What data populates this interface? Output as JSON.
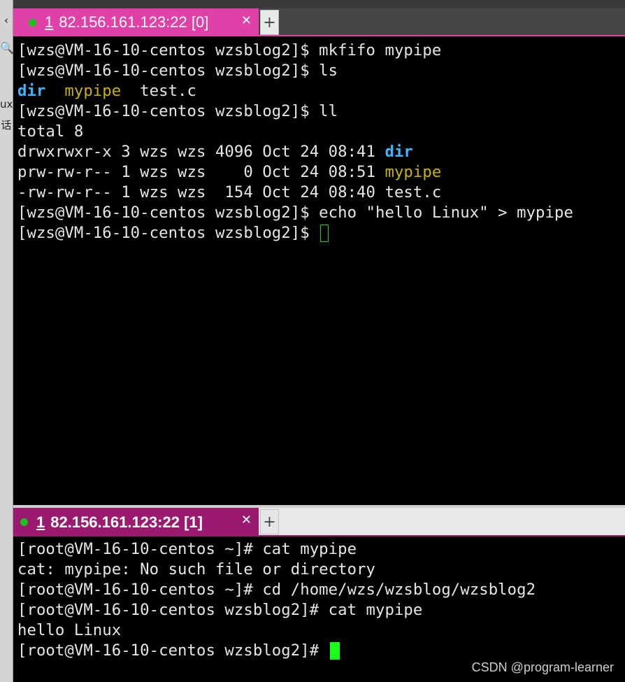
{
  "left_strip": {
    "glyphs": [
      "‹",
      "🔍",
      "ux",
      "话"
    ]
  },
  "top_pane": {
    "tab": {
      "number": "1",
      "title": "82.156.161.123:22 [0]",
      "status_color": "#19c319",
      "accent": "#e040a8"
    },
    "lines": [
      {
        "parts": [
          {
            "text": "[wzs@VM-16-10-centos wzsblog2]$ mkfifo mypipe"
          }
        ]
      },
      {
        "parts": [
          {
            "text": "[wzs@VM-16-10-centos wzsblog2]$ ls"
          }
        ]
      },
      {
        "parts": [
          {
            "text": "dir",
            "style": "dir"
          },
          {
            "text": "  "
          },
          {
            "text": "mypipe",
            "style": "pipe"
          },
          {
            "text": "  test.c"
          }
        ]
      },
      {
        "parts": [
          {
            "text": "[wzs@VM-16-10-centos wzsblog2]$ ll"
          }
        ]
      },
      {
        "parts": [
          {
            "text": "total 8"
          }
        ]
      },
      {
        "parts": [
          {
            "text": "drwxrwxr-x 3 wzs wzs 4096 Oct 24 08:41 "
          },
          {
            "text": "dir",
            "style": "dir"
          }
        ]
      },
      {
        "parts": [
          {
            "text": "prw-rw-r-- 1 wzs wzs    0 Oct 24 08:51 "
          },
          {
            "text": "mypipe",
            "style": "pipe"
          }
        ]
      },
      {
        "parts": [
          {
            "text": "-rw-rw-r-- 1 wzs wzs  154 Oct 24 08:40 test.c"
          }
        ]
      },
      {
        "parts": [
          {
            "text": "[wzs@VM-16-10-centos wzsblog2]$ echo \"hello Linux\" > mypipe"
          }
        ]
      },
      {
        "parts": [
          {
            "text": "[wzs@VM-16-10-centos wzsblog2]$ "
          }
        ],
        "cursor": "outline"
      }
    ]
  },
  "bottom_pane": {
    "tab": {
      "number": "1",
      "title": "82.156.161.123:22 [1]",
      "status_color": "#19c319",
      "accent": "#9a1a6f"
    },
    "lines": [
      {
        "parts": [
          {
            "text": "[root@VM-16-10-centos ~]# cat mypipe"
          }
        ]
      },
      {
        "parts": [
          {
            "text": "cat: mypipe: No such file or directory"
          }
        ]
      },
      {
        "parts": [
          {
            "text": "[root@VM-16-10-centos ~]# cd /home/wzs/wzsblog/wzsblog2"
          }
        ]
      },
      {
        "parts": [
          {
            "text": "[root@VM-16-10-centos wzsblog2]# cat mypipe"
          }
        ]
      },
      {
        "parts": [
          {
            "text": "hello Linux"
          }
        ]
      },
      {
        "parts": [
          {
            "text": "[root@VM-16-10-centos wzsblog2]# "
          }
        ],
        "cursor": "solid"
      }
    ]
  },
  "watermark": "CSDN @program-learner",
  "colors": {
    "dir": "#3eb6ff",
    "pipe": "#c8b400",
    "text": "#e6e6e6",
    "cursor": "#19ff19"
  }
}
